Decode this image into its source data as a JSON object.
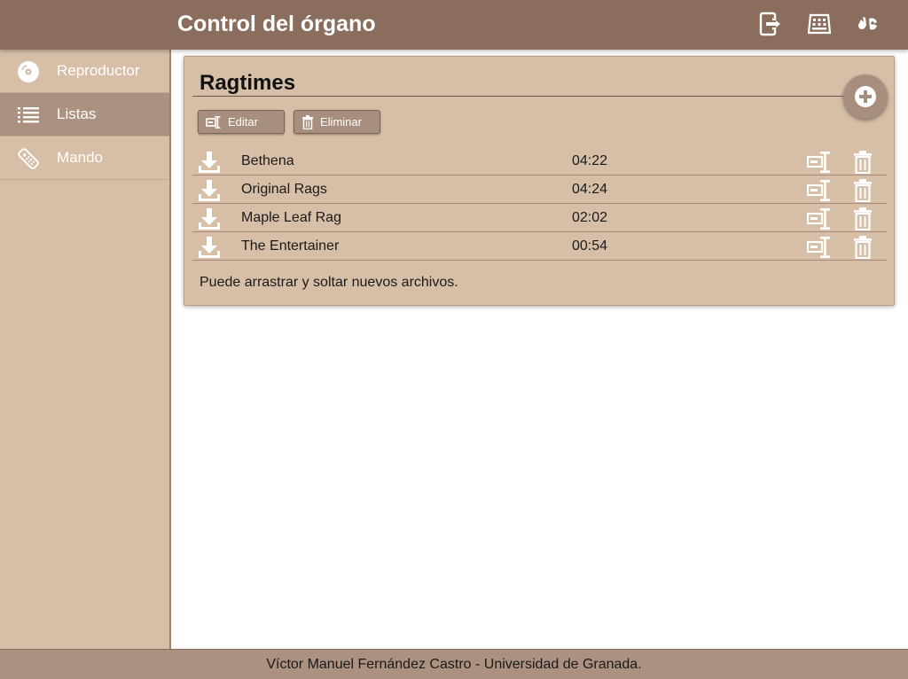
{
  "header": {
    "title": "Control del órgano",
    "icons": [
      "logout-icon",
      "keyboard-icon",
      "accessibility-icon"
    ]
  },
  "sidebar": {
    "items": [
      {
        "label": "Reproductor",
        "icon": "disc-icon",
        "active": false
      },
      {
        "label": "Listas",
        "icon": "list-icon",
        "active": true
      },
      {
        "label": "Mando",
        "icon": "remote-icon",
        "active": false
      }
    ]
  },
  "playlist": {
    "title": "Ragtimes",
    "edit_label": "Editar",
    "delete_label": "Eliminar",
    "tracks": [
      {
        "name": "Bethena",
        "duration": "04:22"
      },
      {
        "name": "Original Rags",
        "duration": "04:24"
      },
      {
        "name": "Maple Leaf Rag",
        "duration": "02:02"
      },
      {
        "name": "The Entertainer",
        "duration": "00:54"
      }
    ],
    "hint": "Puede arrastrar y soltar nuevos archivos."
  },
  "footer": {
    "text": "Víctor Manuel Fernández Castro - Universidad de Granada."
  },
  "colors": {
    "header": "#8b6d5e",
    "sidebar": "#d6bea7",
    "sidebar_active": "#ac9180",
    "card": "#d6bea7",
    "button": "#a88e7e",
    "footer": "#ac9180"
  }
}
